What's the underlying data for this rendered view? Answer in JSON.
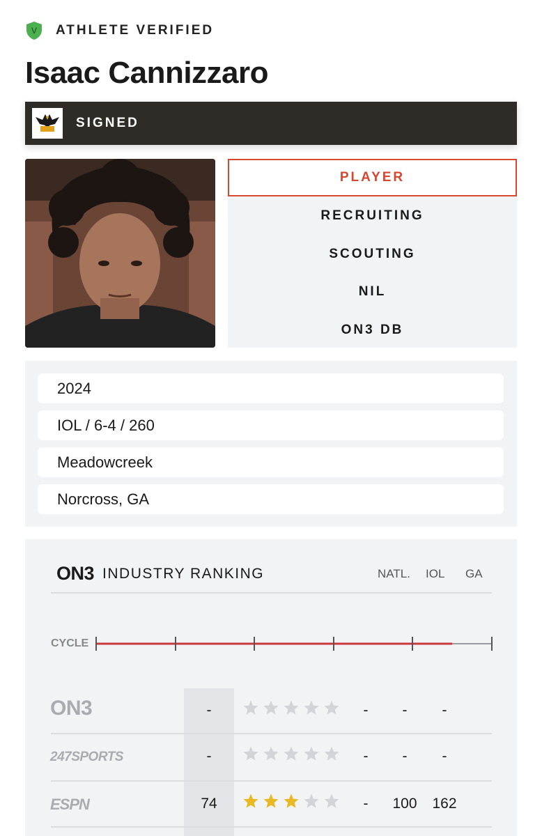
{
  "header": {
    "verified_label": "ATHLETE VERIFIED",
    "verified_badge_letter": "V",
    "athlete_name": "Isaac Cannizzaro",
    "status_label": "SIGNED"
  },
  "tabs": [
    {
      "label": "PLAYER",
      "active": true
    },
    {
      "label": "RECRUITING",
      "active": false
    },
    {
      "label": "SCOUTING",
      "active": false
    },
    {
      "label": "NIL",
      "active": false
    },
    {
      "label": "ON3 DB",
      "active": false
    }
  ],
  "info": {
    "class_year": "2024",
    "position_size": "IOL / 6-4 / 260",
    "school": "Meadowcreek",
    "hometown": "Norcross, GA"
  },
  "ranking": {
    "logo_text": "ON3",
    "title": "INDUSTRY RANKING",
    "columns": [
      "NATL.",
      "IOL",
      "GA"
    ],
    "cycle_label": "CYCLE",
    "cycle_progress": 0.9,
    "rows": [
      {
        "source": "ON3",
        "score": "-",
        "stars": 0,
        "natl": "-",
        "pos": "-",
        "state": "-"
      },
      {
        "source": "247SPORTS",
        "score": "-",
        "stars": 0,
        "natl": "-",
        "pos": "-",
        "state": "-"
      },
      {
        "source": "ESPN",
        "score": "74",
        "stars": 3,
        "natl": "-",
        "pos": "100",
        "state": "162"
      }
    ]
  },
  "colors": {
    "accent": "#d6482d",
    "dark_bar": "#2f2b27",
    "star_filled": "#e8b923",
    "star_empty": "#d3d4d7",
    "verified_green": "#4caf50"
  }
}
